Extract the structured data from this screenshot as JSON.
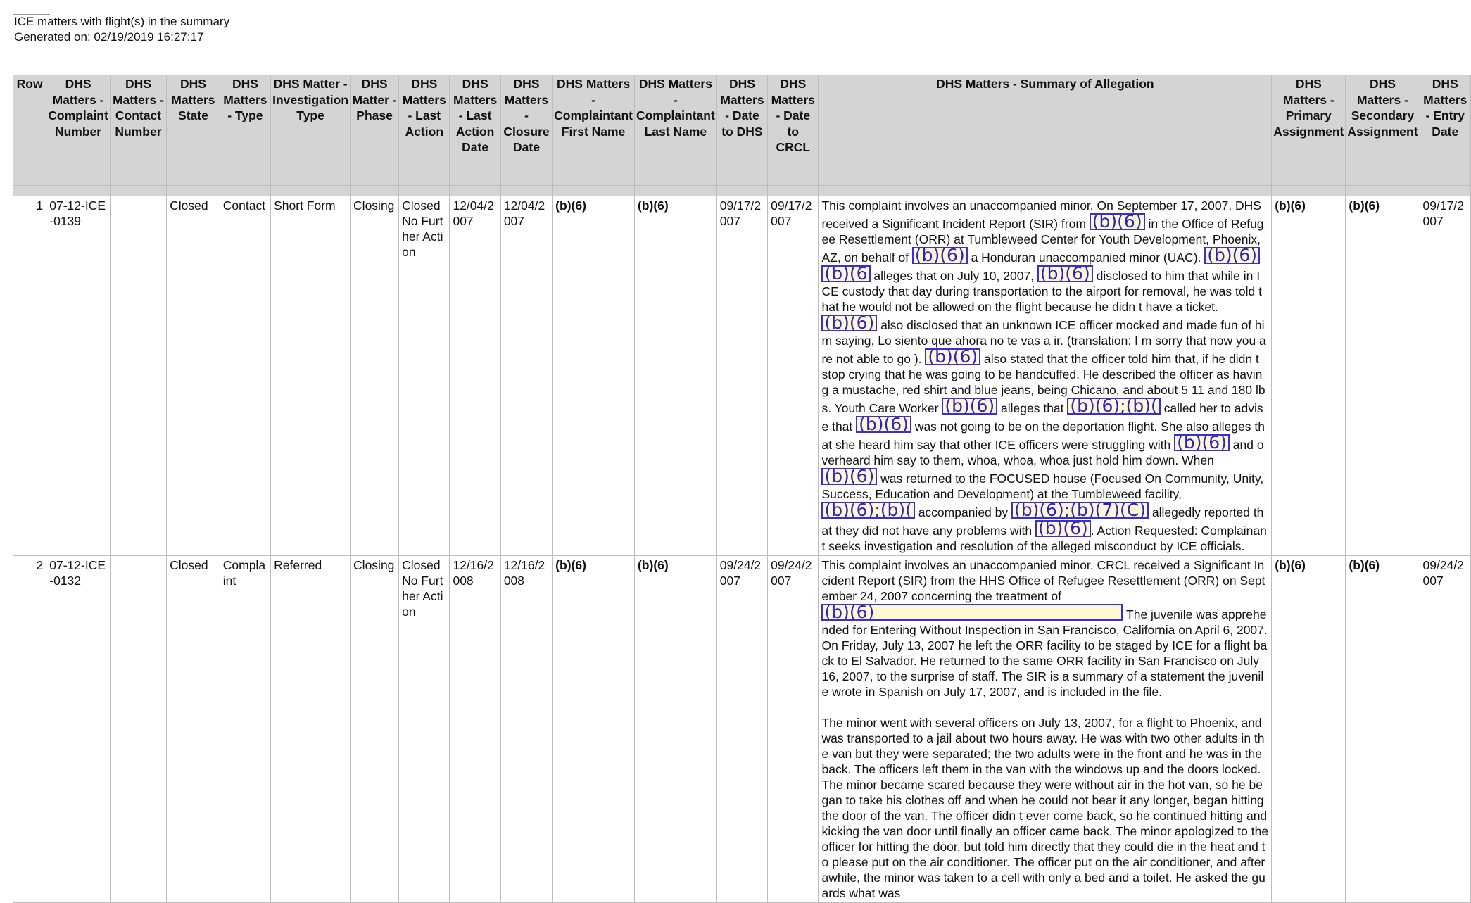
{
  "report": {
    "title": "ICE matters with flight(s) in the summary",
    "generated": "Generated on: 02/19/2019 16:27:17"
  },
  "columns": [
    "Row",
    "DHS Matters - Complaint Number",
    "DHS Matters - Contact Number",
    "DHS Matters State",
    "DHS Matters - Type",
    "DHS Matter - Investigation Type",
    "DHS Matter - Phase",
    "DHS Matters - Last Action",
    "DHS Matters - Last Action Date",
    "DHS Matters - Closure Date",
    "DHS Matters - Complaintant First Name",
    "DHS Matters - Complaintant Last Name",
    "DHS Matters - Date to DHS",
    "DHS Matters - Date to CRCL",
    "DHS Matters - Summary of Allegation",
    "DHS Matters - Primary Assignment",
    "DHS Matters - Secondary Assignment",
    "DHS Matters - Entry Date"
  ],
  "rows": [
    {
      "row": "1",
      "complaint_number": "07-12-ICE-0139",
      "contact_number": "",
      "state": "Closed",
      "type": "Contact",
      "investigation_type": "Short Form",
      "phase": "Closing",
      "last_action": "Closed No Further Action",
      "last_action_date": "12/04/2007",
      "closure_date": "12/04/2007",
      "first_name": "(b)(6)",
      "last_name": "(b)(6)",
      "date_to_dhs": "09/17/2007",
      "date_to_crcl": "09/17/2007",
      "primary": "(b)(6)",
      "secondary": "(b)(6)",
      "entry_date": "09/17/2007",
      "summary": [
        {
          "t": "This complaint involves an unaccompanied minor.  On September 17, 2007, DHS received a Significant Incident Report (SIR) from "
        },
        {
          "r": "(b)(6)"
        },
        {
          "t": " in the Office of Refugee Resettlement (ORR) at Tumbleweed Center for Youth Development, Phoenix, AZ, on behalf of "
        },
        {
          "r": "(b)(6)"
        },
        {
          "t": " a Honduran unaccompanied minor (UAC). "
        },
        {
          "r": "(b)(6)"
        },
        {
          "t": " "
        },
        {
          "r": "(b)(6"
        },
        {
          "t": " alleges that on July 10, 2007, "
        },
        {
          "r": "(b)(6)"
        },
        {
          "t": " disclosed to him that while in ICE custody that day during transportation to the airport for removal, he was told that he would not be allowed on the flight because he didn t have a ticket. "
        },
        {
          "r": "(b)(6)"
        },
        {
          "t": " also disclosed that an unknown ICE officer mocked and made fun of him saying,  Lo siento que ahora no te vas a ir.  (translation:  I m sorry that now you are not able to go ). "
        },
        {
          "r": "(b)(6)"
        },
        {
          "t": " also stated that the officer told him that,  if he didn t stop crying that he was going to be handcuffed.   He described the officer as having a mustache, red shirt and blue jeans, being Chicano, and about 5 11  and 180 lbs.  Youth Care Worker "
        },
        {
          "r": "(b)(6)"
        },
        {
          "t": " alleges that "
        },
        {
          "r": "(b)(6);(b)("
        },
        {
          "t": " called her to advise that "
        },
        {
          "r": "(b)(6)"
        },
        {
          "t": " was not going to be on the deportation flight.  She also alleges that she heard him say that other ICE officers were struggling with "
        },
        {
          "r": "(b)(6)"
        },
        {
          "t": " and overheard him say to them,  whoa, whoa, whoa just hold him down.   When "
        },
        {
          "r": "(b)(6)"
        },
        {
          "t": " was returned to the FOCUSED house (Focused On Community, Unity, Success, Education and Development) at the Tumbleweed facility, "
        },
        {
          "r": "(b)(6);(b)("
        },
        {
          "t": " accompanied by "
        },
        {
          "r": "(b)(6);(b)(7)(C)"
        },
        {
          "t": " allegedly reported that they did not have any problems with "
        },
        {
          "r": "(b)(6)"
        },
        {
          "t": ". Action Requested: Complainant seeks investigation and resolution of the alleged misconduct by ICE officials."
        }
      ]
    },
    {
      "row": "2",
      "complaint_number": "07-12-ICE-0132",
      "contact_number": "",
      "state": "Closed",
      "type": "Complaint",
      "investigation_type": "Referred",
      "phase": "Closing",
      "last_action": "Closed No Further Action",
      "last_action_date": "12/16/2008",
      "closure_date": "12/16/2008",
      "first_name": "(b)(6)",
      "last_name": "(b)(6)",
      "date_to_dhs": "09/24/2007",
      "date_to_crcl": "09/24/2007",
      "primary": "(b)(6)",
      "secondary": "(b)(6)",
      "entry_date": "09/24/2007",
      "summary": [
        {
          "t": "This complaint involves an unaccompanied minor. CRCL received a Significant Incident Report (SIR) from the HHS Office of Refugee Resettlement (ORR) on September 24, 2007 concerning the treatment of "
        },
        {
          "r": "(b)(6)",
          "wide": true
        },
        {
          "t": " The juvenile was apprehended for Entering Without Inspection in San Francisco, California on April 6, 2007. On Friday, July 13, 2007 he left the ORR facility  to be staged  by ICE for a flight back to El Salvador.  He returned to the same ORR facility in San Francisco on July 16, 2007,  to the surprise of staff.   The SIR is a summary of a statement the juvenile wrote in Spanish on July 17, 2007, and is included in the file."
        },
        {
          "br": true
        },
        {
          "br": true
        },
        {
          "t": "The minor went with several officers on July 13, 2007, for a flight to Phoenix, and was transported to a jail about two hours away.  He was with two other adults in the van but they were separated; the two adults were in the front and he was in the back.  The officers left them in the van with the windows up and the doors locked.  The minor became scared because they were without air in the hot van, so he began to take his clothes off and when he could not bear it any longer, began hitting the door of the van.  The officer didn t ever come back, so he continued hitting and kicking the van door until finally an officer came back.  The minor apologized to the officer for hitting the door, but told him directly that they could die in the heat and to please put on the air conditioner.  The officer put on the air conditioner, and after awhile, the minor was taken to a cell with only a bed and a toilet.  He asked the guards what was"
        }
      ]
    }
  ]
}
